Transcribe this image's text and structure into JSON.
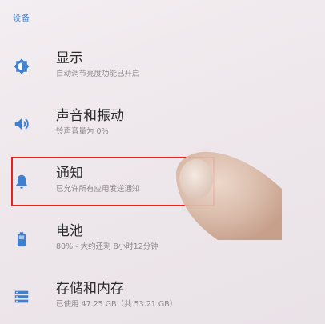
{
  "section_header": "设备",
  "items": [
    {
      "title": "显示",
      "subtitle": "自动调节亮度功能已开启",
      "icon": "brightness-icon"
    },
    {
      "title": "声音和振动",
      "subtitle": "铃声音量为 0%",
      "icon": "volume-icon"
    },
    {
      "title": "通知",
      "subtitle": "已允许所有应用发送通知",
      "icon": "bell-icon"
    },
    {
      "title": "电池",
      "subtitle": "80% - 大约还剩 8小时12分钟",
      "icon": "battery-icon"
    },
    {
      "title": "存储和内存",
      "subtitle": "已使用 47.25 GB（共 53.21 GB）",
      "icon": "storage-icon"
    }
  ],
  "colors": {
    "accent": "#3f7fd0",
    "highlight": "#e8231f"
  }
}
